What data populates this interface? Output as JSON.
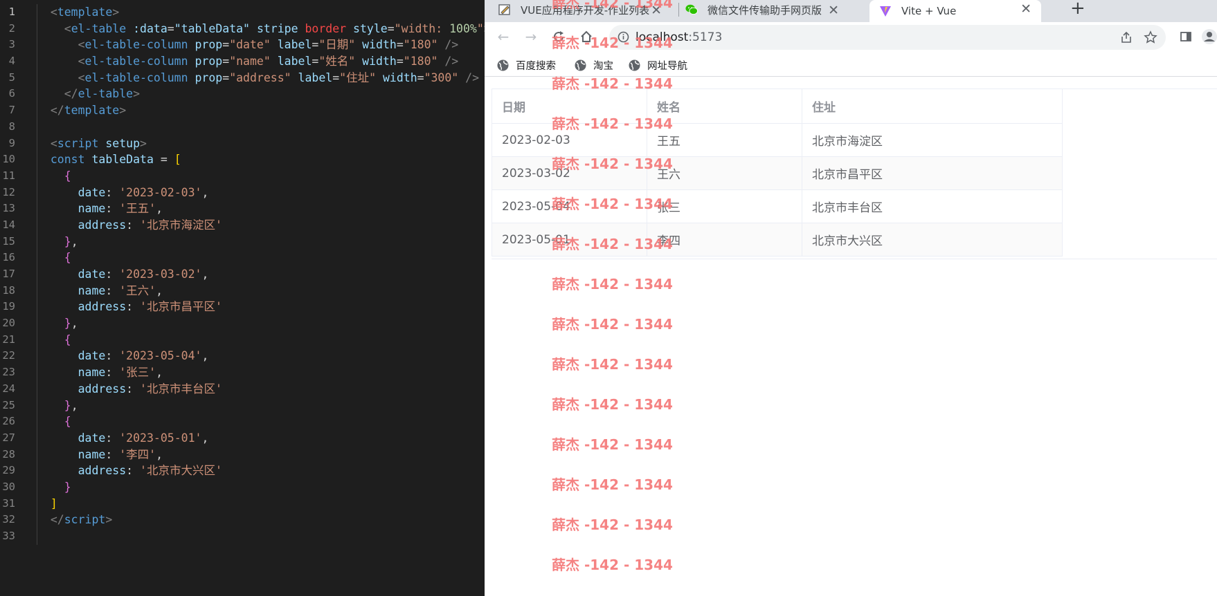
{
  "editor": {
    "lines": [
      [
        [
          "  ",
          "t-op"
        ],
        [
          "<",
          "t-punct"
        ],
        [
          "template",
          "t-tag"
        ],
        [
          ">",
          "t-punct"
        ]
      ],
      [
        [
          "    ",
          "t-op"
        ],
        [
          "<",
          "t-punct"
        ],
        [
          "el-table",
          "t-tag"
        ],
        [
          " ",
          "t-op"
        ],
        [
          ":data",
          "t-attr"
        ],
        [
          "=",
          "t-op"
        ],
        [
          "\"tableData\"",
          "t-bind"
        ],
        [
          " ",
          "t-op"
        ],
        [
          "stripe",
          "t-attr"
        ],
        [
          " ",
          "t-op"
        ],
        [
          "border",
          "t-red"
        ],
        [
          " ",
          "t-op"
        ],
        [
          "style",
          "t-attr"
        ],
        [
          "=",
          "t-op"
        ],
        [
          "\"width: ",
          "t-str"
        ],
        [
          "100%",
          "t-num"
        ],
        [
          "\"",
          "t-str"
        ],
        [
          ">",
          "t-punct"
        ]
      ],
      [
        [
          "      ",
          "t-op"
        ],
        [
          "<",
          "t-punct"
        ],
        [
          "el-table-column",
          "t-tag"
        ],
        [
          " ",
          "t-op"
        ],
        [
          "prop",
          "t-attr"
        ],
        [
          "=",
          "t-op"
        ],
        [
          "\"date\"",
          "t-str"
        ],
        [
          " ",
          "t-op"
        ],
        [
          "label",
          "t-attr"
        ],
        [
          "=",
          "t-op"
        ],
        [
          "\"日期\"",
          "t-str"
        ],
        [
          " ",
          "t-op"
        ],
        [
          "width",
          "t-attr"
        ],
        [
          "=",
          "t-op"
        ],
        [
          "\"180\"",
          "t-str"
        ],
        [
          " />",
          "t-punct"
        ]
      ],
      [
        [
          "      ",
          "t-op"
        ],
        [
          "<",
          "t-punct"
        ],
        [
          "el-table-column",
          "t-tag"
        ],
        [
          " ",
          "t-op"
        ],
        [
          "prop",
          "t-attr"
        ],
        [
          "=",
          "t-op"
        ],
        [
          "\"name\"",
          "t-str"
        ],
        [
          " ",
          "t-op"
        ],
        [
          "label",
          "t-attr"
        ],
        [
          "=",
          "t-op"
        ],
        [
          "\"姓名\"",
          "t-str"
        ],
        [
          " ",
          "t-op"
        ],
        [
          "width",
          "t-attr"
        ],
        [
          "=",
          "t-op"
        ],
        [
          "\"180\"",
          "t-str"
        ],
        [
          " />",
          "t-punct"
        ]
      ],
      [
        [
          "      ",
          "t-op"
        ],
        [
          "<",
          "t-punct"
        ],
        [
          "el-table-column",
          "t-tag"
        ],
        [
          " ",
          "t-op"
        ],
        [
          "prop",
          "t-attr"
        ],
        [
          "=",
          "t-op"
        ],
        [
          "\"address\"",
          "t-str"
        ],
        [
          " ",
          "t-op"
        ],
        [
          "label",
          "t-attr"
        ],
        [
          "=",
          "t-op"
        ],
        [
          "\"住址\"",
          "t-str"
        ],
        [
          " ",
          "t-op"
        ],
        [
          "width",
          "t-attr"
        ],
        [
          "=",
          "t-op"
        ],
        [
          "\"300\"",
          "t-str"
        ],
        [
          " />",
          "t-punct"
        ]
      ],
      [
        [
          "    ",
          "t-op"
        ],
        [
          "</",
          "t-punct"
        ],
        [
          "el-table",
          "t-tag"
        ],
        [
          ">",
          "t-punct"
        ]
      ],
      [
        [
          "  ",
          "t-op"
        ],
        [
          "</",
          "t-punct"
        ],
        [
          "template",
          "t-tag"
        ],
        [
          ">",
          "t-punct"
        ]
      ],
      [],
      [
        [
          "  ",
          "t-op"
        ],
        [
          "<",
          "t-punct"
        ],
        [
          "script",
          "t-tag"
        ],
        [
          " ",
          "t-op"
        ],
        [
          "setup",
          "t-attr"
        ],
        [
          ">",
          "t-punct"
        ]
      ],
      [
        [
          "  ",
          "t-op"
        ],
        [
          "const",
          "t-kw"
        ],
        [
          " ",
          "t-op"
        ],
        [
          "tableData",
          "t-var"
        ],
        [
          " = ",
          "t-op"
        ],
        [
          "[",
          "t-br1"
        ]
      ],
      [
        [
          "    ",
          "t-op"
        ],
        [
          "{",
          "t-br2"
        ]
      ],
      [
        [
          "      ",
          "t-op"
        ],
        [
          "date",
          "t-prop"
        ],
        [
          ": ",
          "t-op"
        ],
        [
          "'2023-02-03'",
          "t-str"
        ],
        [
          ",",
          "t-op"
        ]
      ],
      [
        [
          "      ",
          "t-op"
        ],
        [
          "name",
          "t-prop"
        ],
        [
          ": ",
          "t-op"
        ],
        [
          "'王五'",
          "t-str"
        ],
        [
          ",",
          "t-op"
        ]
      ],
      [
        [
          "      ",
          "t-op"
        ],
        [
          "address",
          "t-prop"
        ],
        [
          ": ",
          "t-op"
        ],
        [
          "'北京市海淀区'",
          "t-str"
        ]
      ],
      [
        [
          "    ",
          "t-op"
        ],
        [
          "}",
          "t-br2"
        ],
        [
          ",",
          "t-op"
        ]
      ],
      [
        [
          "    ",
          "t-op"
        ],
        [
          "{",
          "t-br2"
        ]
      ],
      [
        [
          "      ",
          "t-op"
        ],
        [
          "date",
          "t-prop"
        ],
        [
          ": ",
          "t-op"
        ],
        [
          "'2023-03-02'",
          "t-str"
        ],
        [
          ",",
          "t-op"
        ]
      ],
      [
        [
          "      ",
          "t-op"
        ],
        [
          "name",
          "t-prop"
        ],
        [
          ": ",
          "t-op"
        ],
        [
          "'王六'",
          "t-str"
        ],
        [
          ",",
          "t-op"
        ]
      ],
      [
        [
          "      ",
          "t-op"
        ],
        [
          "address",
          "t-prop"
        ],
        [
          ": ",
          "t-op"
        ],
        [
          "'北京市昌平区'",
          "t-str"
        ]
      ],
      [
        [
          "    ",
          "t-op"
        ],
        [
          "}",
          "t-br2"
        ],
        [
          ",",
          "t-op"
        ]
      ],
      [
        [
          "    ",
          "t-op"
        ],
        [
          "{",
          "t-br2"
        ]
      ],
      [
        [
          "      ",
          "t-op"
        ],
        [
          "date",
          "t-prop"
        ],
        [
          ": ",
          "t-op"
        ],
        [
          "'2023-05-04'",
          "t-str"
        ],
        [
          ",",
          "t-op"
        ]
      ],
      [
        [
          "      ",
          "t-op"
        ],
        [
          "name",
          "t-prop"
        ],
        [
          ": ",
          "t-op"
        ],
        [
          "'张三'",
          "t-str"
        ],
        [
          ",",
          "t-op"
        ]
      ],
      [
        [
          "      ",
          "t-op"
        ],
        [
          "address",
          "t-prop"
        ],
        [
          ": ",
          "t-op"
        ],
        [
          "'北京市丰台区'",
          "t-str"
        ]
      ],
      [
        [
          "    ",
          "t-op"
        ],
        [
          "}",
          "t-br2"
        ],
        [
          ",",
          "t-op"
        ]
      ],
      [
        [
          "    ",
          "t-op"
        ],
        [
          "{",
          "t-br2"
        ]
      ],
      [
        [
          "      ",
          "t-op"
        ],
        [
          "date",
          "t-prop"
        ],
        [
          ": ",
          "t-op"
        ],
        [
          "'2023-05-01'",
          "t-str"
        ],
        [
          ",",
          "t-op"
        ]
      ],
      [
        [
          "      ",
          "t-op"
        ],
        [
          "name",
          "t-prop"
        ],
        [
          ": ",
          "t-op"
        ],
        [
          "'李四'",
          "t-str"
        ],
        [
          ",",
          "t-op"
        ]
      ],
      [
        [
          "      ",
          "t-op"
        ],
        [
          "address",
          "t-prop"
        ],
        [
          ": ",
          "t-op"
        ],
        [
          "'北京市大兴区'",
          "t-str"
        ]
      ],
      [
        [
          "    ",
          "t-op"
        ],
        [
          "}",
          "t-br2"
        ]
      ],
      [
        [
          "  ",
          "t-op"
        ],
        [
          "]",
          "t-br1"
        ]
      ],
      [
        [
          "  ",
          "t-op"
        ],
        [
          "</",
          "t-punct"
        ],
        [
          "script",
          "t-tag"
        ],
        [
          ">",
          "t-punct"
        ]
      ],
      []
    ],
    "active_line": 1
  },
  "browser": {
    "tabs": [
      {
        "title": "VUE应用程序开发-作业列表",
        "icon": "edit-document-icon"
      },
      {
        "title": "微信文件传输助手网页版",
        "icon": "wechat-icon"
      },
      {
        "title": "Vite + Vue",
        "icon": "vite-logo-icon",
        "active": true
      }
    ],
    "url_host": "localhost",
    "url_port": ":5173",
    "bookmarks": [
      "百度搜索",
      "淘宝",
      "网址导航"
    ]
  },
  "table": {
    "headers": [
      "日期",
      "姓名",
      "住址"
    ],
    "rows": [
      [
        "2023-02-03",
        "王五",
        "北京市海淀区"
      ],
      [
        "2023-03-02",
        "王六",
        "北京市昌平区"
      ],
      [
        "2023-05-04",
        "张三",
        "北京市丰台区"
      ],
      [
        "2023-05-01",
        "李四",
        "北京市大兴区"
      ]
    ]
  },
  "watermark": "薛杰 -142 - 1344",
  "colors": {
    "editor_bg": "#1e1e1e",
    "watermark": "#f47272",
    "table_border": "#ebeef5",
    "stripe": "#fafafa"
  }
}
